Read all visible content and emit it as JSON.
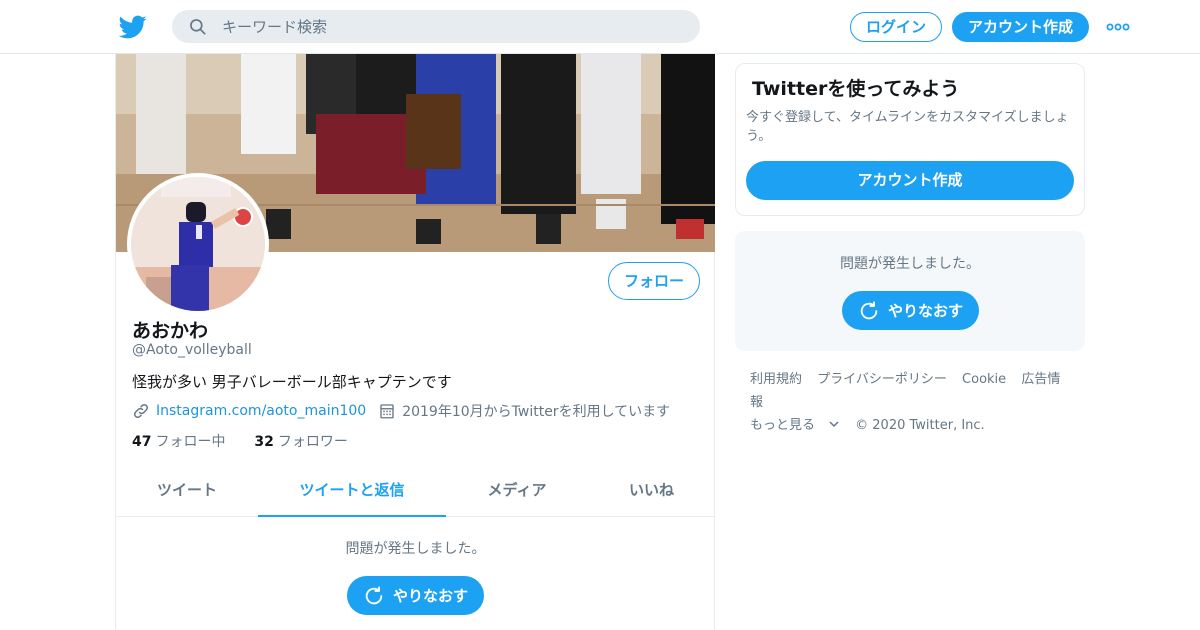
{
  "header": {
    "search_placeholder": "キーワード検索",
    "login_label": "ログイン",
    "signup_label": "アカウント作成"
  },
  "profile": {
    "display_name": "あおかわ",
    "handle": "@Aoto_volleyball",
    "bio": "怪我が多い 男子バレーボール部キャプテンです",
    "link": "Instagram.com/aoto_main100",
    "joined": "2019年10月からTwitterを利用しています",
    "following_count": "47",
    "following_label": "フォロー中",
    "followers_count": "32",
    "followers_label": "フォロワー",
    "follow_label": "フォロー"
  },
  "tabs": [
    {
      "label": "ツイート"
    },
    {
      "label": "ツイートと返信"
    },
    {
      "label": "メディア"
    },
    {
      "label": "いいね"
    }
  ],
  "timeline": {
    "error_text": "問題が発生しました。",
    "retry_label": "やりなおす"
  },
  "sidebar": {
    "promo_title": "Twitterを使ってみよう",
    "promo_text": "今すぐ登録して、タイムラインをカスタマイズしましょう。",
    "promo_button": "アカウント作成",
    "error_text": "問題が発生しました。",
    "retry_label": "やりなおす"
  },
  "footer": {
    "links": [
      "利用規約",
      "プライバシーポリシー",
      "Cookie",
      "広告情報"
    ],
    "more_label": "もっと見る",
    "copyright": "© 2020 Twitter, Inc."
  },
  "colors": {
    "accent": "#1da1f2",
    "secondary_text": "#657786",
    "panel_bg": "#f5f8fa"
  }
}
